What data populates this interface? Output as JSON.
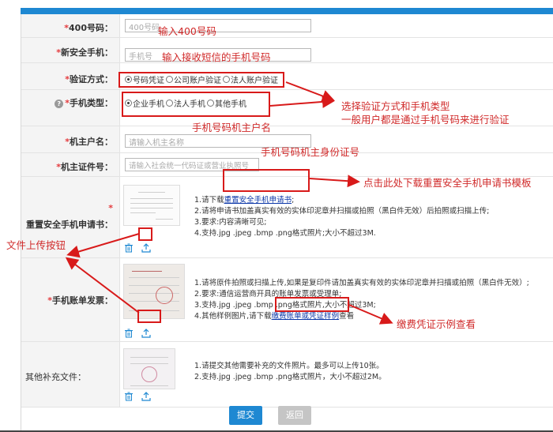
{
  "form": {
    "rows": [
      {
        "label": "400号码：",
        "required": "*",
        "placeholder": "400号码"
      },
      {
        "label": "新安全手机：",
        "required": "*",
        "placeholder": "手机号"
      },
      {
        "label": "验证方式：",
        "required": "*",
        "options": [
          "号码凭证",
          "公司账户验证",
          "法人账户验证"
        ],
        "selected": "号码凭证"
      },
      {
        "label": "手机类型：",
        "required": "*",
        "options": [
          "企业手机",
          "法人手机",
          "其他手机"
        ],
        "selected": "企业手机"
      },
      {
        "label": "机主户名：",
        "required": "*",
        "placeholder": "请输入机主名称"
      },
      {
        "label": "机主证件号：",
        "required": "*",
        "placeholder": "请输入社会统一代码证或营业执照号"
      },
      {
        "label": "重置安全手机申请书：",
        "required": "*"
      },
      {
        "label": "手机账单发票：",
        "required": "*"
      },
      {
        "label": "其他补充文件："
      }
    ],
    "application_info": {
      "line1_prefix": "1.请下载",
      "line1_link": "重置安全手机申请书",
      "line1_suffix": ";",
      "line2": "2.请将申请书加盖真实有效的实体印泥章并扫描或拍照（黑白件无效）后拍照或扫描上传;",
      "line3": "3.要求:内容清晰可见;",
      "line4": "4.支持.jpg .jpeg .bmp .png格式照片;大小不超过3M."
    },
    "bill_info": {
      "line1": "1.请将原件拍照或扫描上传,如果是复印件请加盖真实有效的实体印泥章并扫描或拍照（黑白件无效）;",
      "line2": "2.要求:通信运营商开具的账单发票或受理单;",
      "line3": "3.支持.jpg .jpeg .bmp .png格式照片,大小不超过3M;",
      "line4_prefix": "4.其他样例图片,请下载",
      "line4_link": "缴费账单或凭证样例",
      "line4_suffix": "查看"
    },
    "other_info": {
      "line1": "1.请提交其他需要补充的文件照片。最多可以上传10张。",
      "line2": "2.支持.jpg .jpeg .bmp .png格式照片，大小不超过2M。"
    },
    "submit_label": "提交",
    "back_label": "返回",
    "help_icon": "?"
  },
  "annotations": {
    "a400": "输入400号码",
    "phone": "输入接收短信的手机号码",
    "method_line1": "选择验证方式和手机类型",
    "method_line2": "一般用户都是通过手机号码来进行验证",
    "owner_name": "手机号码机主户名",
    "owner_id": "手机号码机主身份证号",
    "download": "点击此处下载重置安全手机申请书模板",
    "upload": "文件上传按钮",
    "sample": "缴费凭证示例查看"
  },
  "colors": {
    "accent": "#1e88d2",
    "annotation": "#d02a2a",
    "link": "#0a36a8",
    "required": "#e4393c"
  }
}
